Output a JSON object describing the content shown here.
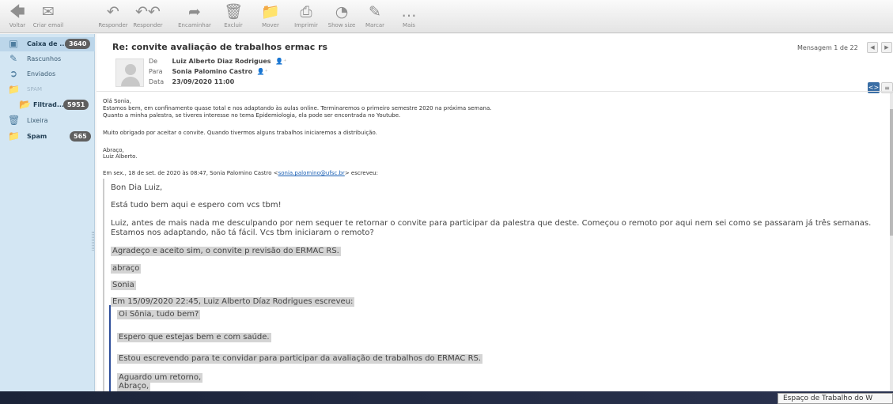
{
  "toolbar": {
    "back": {
      "label": "Voltar",
      "icon": "arrow-left-icon"
    },
    "compose": {
      "label": "Criar email",
      "icon": "envelope-plus-icon"
    },
    "reply": {
      "label": "Responder",
      "icon": "reply-icon"
    },
    "reply_all": {
      "label": "Responder",
      "icon": "reply-all-icon"
    },
    "forward": {
      "label": "Encaminhar",
      "icon": "forward-icon"
    },
    "delete": {
      "label": "Excluir",
      "icon": "trash-icon"
    },
    "move": {
      "label": "Mover",
      "icon": "folder-move-icon"
    },
    "print": {
      "label": "Imprimir",
      "icon": "printer-icon"
    },
    "show_size": {
      "label": "Show size",
      "icon": "pie-chart-icon"
    },
    "mark": {
      "label": "Marcar",
      "icon": "pencil-icon"
    },
    "more": {
      "label": "Mais",
      "icon": "more-dots-icon"
    }
  },
  "sidebar": {
    "folders": [
      {
        "label": "Caixa de ...",
        "badge": "3640",
        "icon": "inbox-icon"
      },
      {
        "label": "Rascunhos",
        "badge": "",
        "icon": "pencil-icon"
      },
      {
        "label": "Enviados",
        "badge": "",
        "icon": "sent-icon"
      },
      {
        "label": "SPAM",
        "badge": "",
        "icon": "folder-icon"
      },
      {
        "label": "Filtrad...",
        "badge": "5951",
        "icon": "filter-folder-icon"
      },
      {
        "label": "Lixeira",
        "badge": "",
        "icon": "trash-icon"
      },
      {
        "label": "Spam",
        "badge": "565",
        "icon": "folder-icon"
      }
    ]
  },
  "message": {
    "subject": "Re: convite avaliação de trabalhos ermac rs",
    "from_label": "De",
    "from": "Luiz Alberto Diaz Rodrigues",
    "to_label": "Para",
    "to": "Sonia Palomino Castro",
    "date_label": "Data",
    "date": "23/09/2020 11:00",
    "counter": "Mensagem 1 de 22",
    "body_lines": [
      "Olá Sonia,",
      "Estamos bem, em confinamento quase total e nos adaptando às aulas online. Terminaremos o primeiro semestre 2020 na próxima semana.",
      "Quanto a minha palestra, se tiveres interesse no tema Epidemiologia, ela pode ser encontrada no Youtube.",
      "Muito obrigado por aceitar o convite. Quando tivermos alguns trabalhos iniciaremos a distribuição.",
      "Abraço,",
      "Luiz Alberto."
    ],
    "quote_header_prefix": "Em sex., 18 de set. de 2020 às 08:47, Sonia Palomino Castro <",
    "quote_header_email": "sonia.palomino@ufsc.br",
    "quote_header_suffix": "> escreveu:",
    "quote_lines": [
      "Bon Dia Luiz,",
      "Está tudo bem aqui e espero com vcs tbm!",
      "Luiz, antes de mais nada me desculpando por nem sequer te retornar o convite para participar da palestra que deste. Começou o remoto por aqui nem sei como se passaram já três semanas.",
      "Estamos nos adaptando, não tá fácil. Vcs tbm iniciaram o remoto?",
      "Agradeço e  aceito sim, o convite p revisão do ERMAC RS.",
      "abraço",
      "Sonia",
      "Em 15/09/2020 22:45, Luiz Alberto Díaz Rodrigues escreveu:"
    ],
    "inner_quote_lines": [
      "Oi Sônia, tudo bem?",
      "Espero que estejas bem e com saúde.",
      "Estou escrevendo para te convidar para participar da avaliação de trabalhos do ERMAC RS.",
      "Aguardo um retorno,",
      "Abraço,"
    ]
  },
  "taskbar": {
    "tooltip": "Espaço de Trabalho do W"
  }
}
